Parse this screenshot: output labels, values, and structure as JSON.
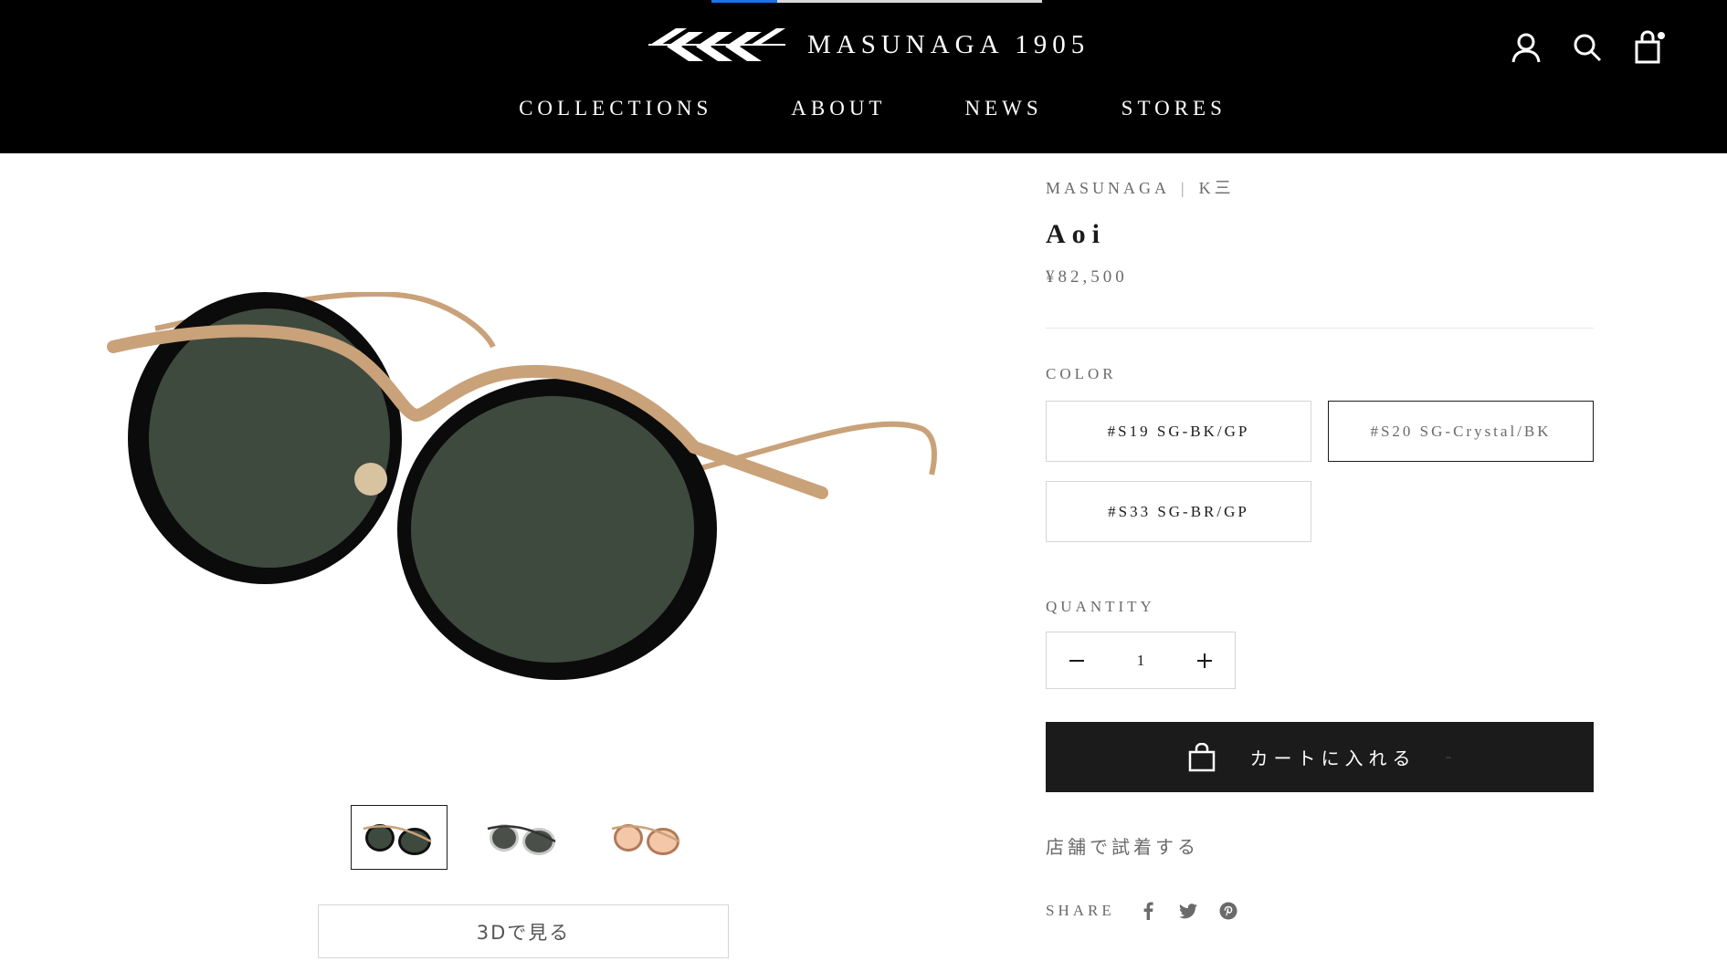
{
  "header": {
    "brand": "MASUNAGA 1905",
    "nav": [
      "COLLECTIONS",
      "ABOUT",
      "NEWS",
      "STORES"
    ],
    "icons": [
      "account-icon",
      "search-icon",
      "cart-icon"
    ]
  },
  "gallery": {
    "thumbnails": [
      "thumb-black-gold",
      "thumb-crystal-black",
      "thumb-brown-gold"
    ],
    "active_index": 0,
    "view_3d_label": "3Dで見る"
  },
  "product": {
    "vendor": "MASUNAGA",
    "vendor_sep": "|",
    "collection": "K三",
    "title": "Aoi",
    "price": "¥82,500",
    "color_label": "COLOR",
    "colors": [
      "#S19 SG-BK/GP",
      "#S20 SG-Crystal/BK",
      "#S33 SG-BR/GP"
    ],
    "selected_color_index": 1,
    "quantity_label": "QUANTITY",
    "quantity": "1",
    "add_to_cart": "カートに入れる",
    "cart_dash": "–",
    "try_in_store": "店舗で試着する",
    "share_label": "SHARE",
    "share_icons": [
      "facebook-icon",
      "twitter-icon",
      "pinterest-icon"
    ]
  },
  "colors": {
    "header_bg": "#000000",
    "text": "#1c1b1b",
    "muted": "#6a6a6a",
    "border": "#d6d6d6",
    "button_bg": "#1c1b1b",
    "gold": "#c9a27a",
    "lens": "#3f4a3f"
  }
}
